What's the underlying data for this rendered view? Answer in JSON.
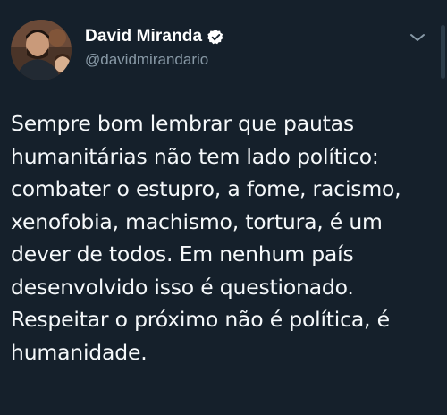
{
  "tweet": {
    "author": {
      "display_name": "David Miranda",
      "handle": "@davidmirandario",
      "verified": true,
      "avatar_icon": "profile-photo"
    },
    "menu_icon": "chevron-down-icon",
    "text_lines": [
      "Sempre bom lembrar que pautas",
      "humanitárias não tem lado político:",
      "combater o estupro, a fome, racismo,",
      "xenofobia, machismo, tortura, é um",
      "dever de todos. Em nenhum país",
      "desenvolvido isso é questionado.",
      "Respeitar o próximo não é política, é",
      "humanidade."
    ]
  },
  "colors": {
    "background": "#15202b",
    "text": "#f5f8fa",
    "secondary_text": "#8899a6",
    "verified_badge": "#ffffff"
  }
}
